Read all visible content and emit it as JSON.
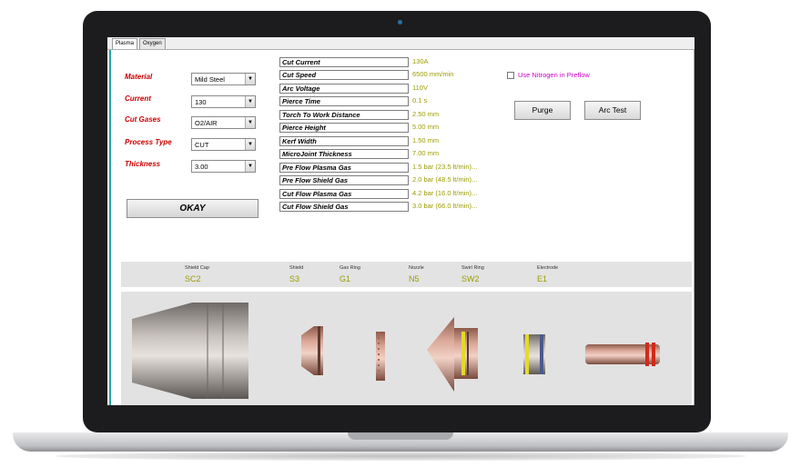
{
  "tabs": [
    "Plasma",
    "Oxygen"
  ],
  "settings": [
    {
      "label": "Material",
      "value": "Mild Steel"
    },
    {
      "label": "Current",
      "value": "130"
    },
    {
      "label": "Cut Gases",
      "value": "O2/AIR"
    },
    {
      "label": "Process Type",
      "value": "CUT"
    },
    {
      "label": "Thickness",
      "value": "3.00"
    }
  ],
  "okay_label": "OKAY",
  "parameters": [
    {
      "name": "Cut Current",
      "value": "130A"
    },
    {
      "name": "Cut Speed",
      "value": "6500 mm/min"
    },
    {
      "name": "Arc Voltage",
      "value": "110V"
    },
    {
      "name": "Pierce Time",
      "value": "0.1 s"
    },
    {
      "name": "Torch To Work Distance",
      "value": "2.50 mm"
    },
    {
      "name": "Pierce Height",
      "value": "5.00 mm"
    },
    {
      "name": "Kerf Width",
      "value": "1.50 mm"
    },
    {
      "name": "MicroJoint Thickness",
      "value": "7.00 mm"
    },
    {
      "name": "Pre Flow Plasma Gas",
      "value": "1.5 bar (23.5 lt/min)..."
    },
    {
      "name": "Pre Flow Shield Gas",
      "value": "2.0 bar (48.5 lt/min)..."
    },
    {
      "name": "Cut Flow Plasma Gas",
      "value": "4.2 bar (16.0 lt/min)..."
    },
    {
      "name": "Cut Flow Shield Gas",
      "value": "3.0 bar (66.0 lt/min)..."
    }
  ],
  "nitrogen_checkbox": {
    "label": "Use Nitrogen in Preflow",
    "checked": false
  },
  "buttons": {
    "purge": "Purge",
    "arc_test": "Arc Test"
  },
  "consumables": [
    {
      "name": "Shield Cap",
      "code": "SC2"
    },
    {
      "name": "Shield",
      "code": "S3"
    },
    {
      "name": "Gas Ring",
      "code": "G1"
    },
    {
      "name": "Nozzle",
      "code": "N5"
    },
    {
      "name": "Swirl Ring",
      "code": "SW2"
    },
    {
      "name": "Electrode",
      "code": "E1"
    }
  ],
  "colors": {
    "label_red": "#cc0000",
    "value_olive": "#9b9b00",
    "checkbox_magenta": "#cc00cc",
    "accent_teal": "#2aa3a3"
  }
}
